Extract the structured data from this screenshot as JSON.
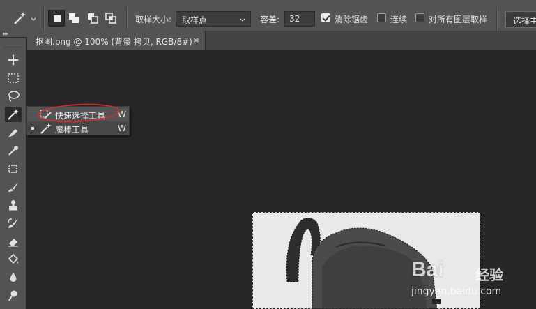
{
  "options_bar": {
    "sample_size_label": "取样大小:",
    "sample_size_value": "取样点",
    "tolerance_label": "容差:",
    "tolerance_value": "32",
    "anti_alias_label": "消除锯齿",
    "anti_alias_checked": true,
    "contiguous_label": "连续",
    "contiguous_checked": false,
    "sample_all_layers_label": "对所有图层取样",
    "sample_all_layers_checked": false,
    "select_subject_label": "选择主体"
  },
  "document_tab": {
    "title": "抠图.png @ 100% (背景 拷贝, RGB/8#) *",
    "close": "×"
  },
  "tool_flyout": {
    "items": [
      {
        "label": "快速选择工具",
        "shortcut": "W",
        "icon": "quick-selection-icon",
        "active": false
      },
      {
        "label": "魔棒工具",
        "shortcut": "W",
        "icon": "magic-wand-icon",
        "active": true
      }
    ]
  },
  "toolbar": {
    "tools": [
      "move-icon",
      "marquee-icon",
      "lasso-icon",
      "magic-wand-icon",
      "pen-icon",
      "eyedropper-icon",
      "crop-icon",
      "brush-icon",
      "stamp-icon",
      "history-brush-icon",
      "eraser-icon",
      "paint-bucket-icon",
      "blur-icon",
      "dodge-icon"
    ]
  },
  "watermark": {
    "brand": "Bai",
    "brand2": "经验",
    "url": "jingyan.baidu.com"
  },
  "colors": {
    "panel": "#535353",
    "canvas": "#282629",
    "highlight_ring": "#c8302b"
  }
}
